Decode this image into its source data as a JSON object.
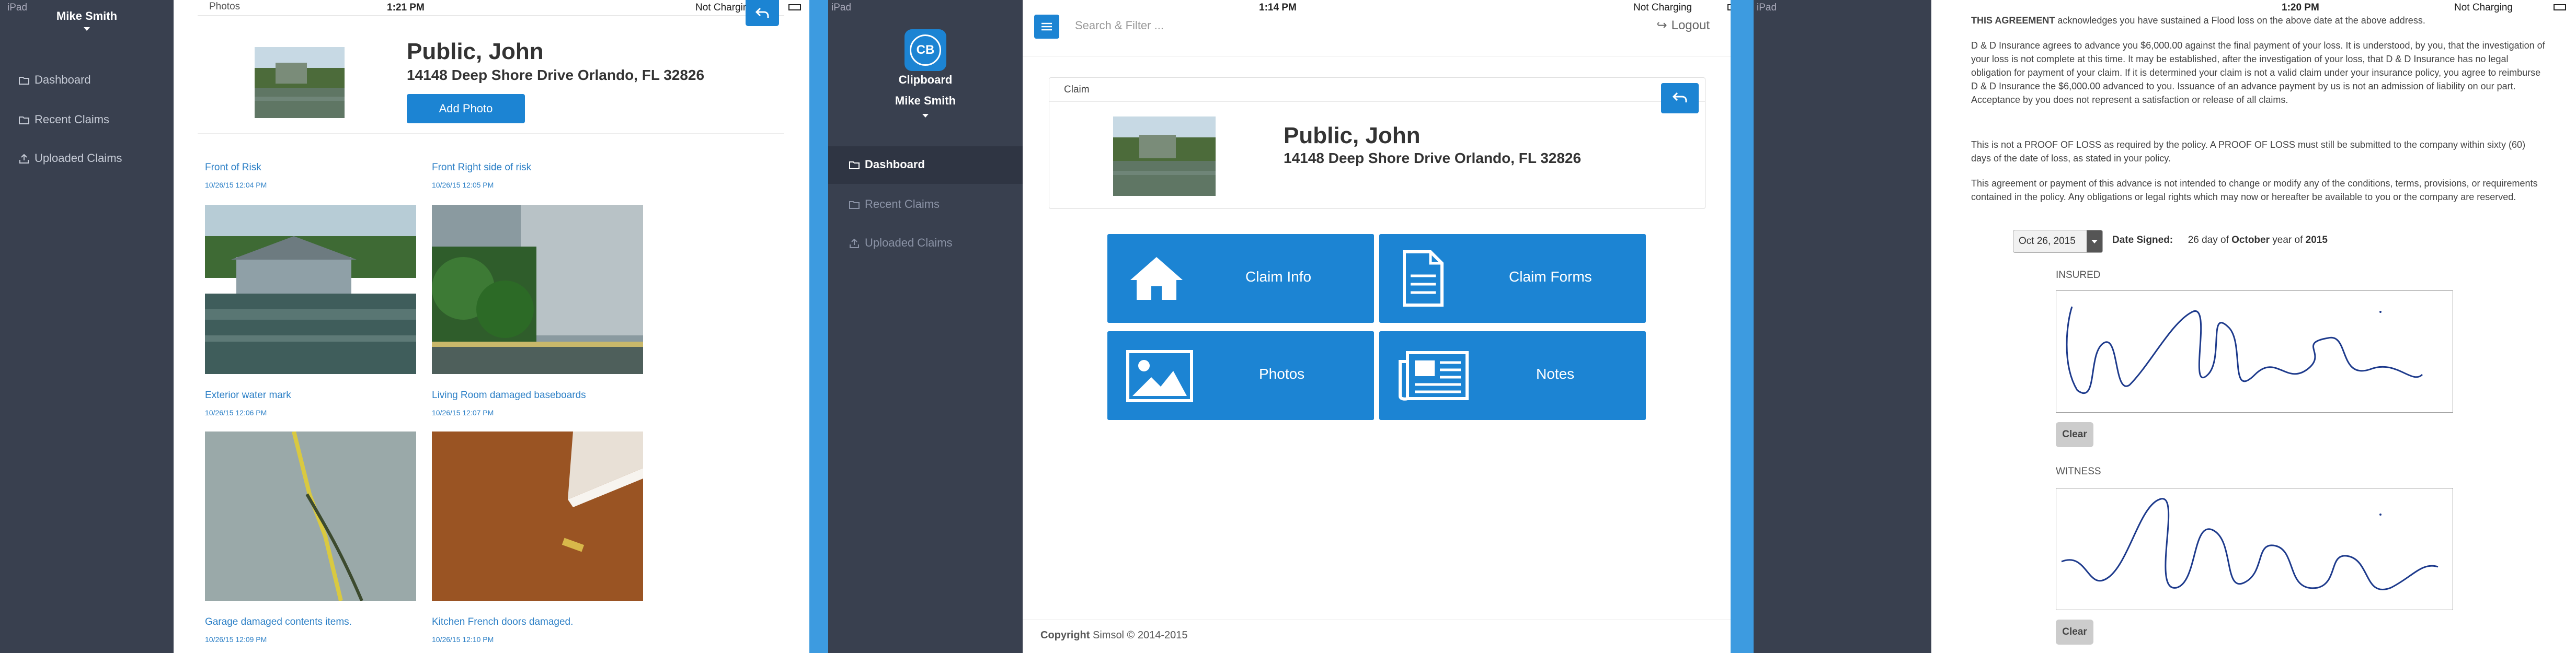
{
  "panel1": {
    "status": {
      "device": "iPad",
      "time": "1:21 PM",
      "battery": "Not Charging"
    },
    "user": "Mike Smith",
    "nav": [
      "Dashboard",
      "Recent Claims",
      "Uploaded Claims"
    ],
    "section_title": "Photos",
    "claimant": {
      "name": "Public, John",
      "address": "14148 Deep Shore Drive Orlando, FL 32826"
    },
    "add_photo": "Add Photo",
    "photos": [
      {
        "caption": "Front of Risk",
        "time": "10/26/15 12:04 PM"
      },
      {
        "caption": "Front Right side of risk",
        "time": "10/26/15 12:05 PM"
      },
      {
        "caption": "Exterior water mark",
        "time": "10/26/15 12:06 PM"
      },
      {
        "caption": "Living Room damaged baseboards",
        "time": "10/26/15 12:07 PM"
      },
      {
        "caption": "Garage damaged contents items.",
        "time": "10/26/15 12:09 PM"
      },
      {
        "caption": "Kitchen French doors damaged.",
        "time": "10/26/15 12:10 PM"
      }
    ]
  },
  "panel2": {
    "status": {
      "device": "iPad",
      "time": "1:14 PM",
      "battery": "Not Charging"
    },
    "app_name": "Clipboard",
    "logo_text": "CB",
    "user": "Mike Smith",
    "nav": [
      "Dashboard",
      "Recent Claims",
      "Uploaded Claims"
    ],
    "search_placeholder": "Search & Filter ...",
    "logout": "Logout",
    "claim_label": "Claim",
    "claimant": {
      "name": "Public, John",
      "address": "14148 Deep Shore Drive Orlando, FL 32826"
    },
    "tiles": [
      "Claim Info",
      "Claim Forms",
      "Photos",
      "Notes"
    ],
    "footer_bold": "Copyright",
    "footer_rest": " Simsol © 2014-2015"
  },
  "panel3": {
    "status": {
      "device": "iPad",
      "time": "1:20 PM",
      "battery": "Not Charging"
    },
    "top_line_bold": "THIS AGREEMENT",
    "top_line_rest": " acknowledges you have sustained a Flood loss on the above date at the above address.",
    "para1": "D & D Insurance agrees to advance you $6,000.00 against the final payment of your loss. It is understood, by you, that the investigation of your loss is not complete at this time. It may be established, after the investigation of your loss, that D & D Insurance has no legal obligation for payment of your claim. If it is determined your claim is not a valid claim under your insurance policy, you agree to reimburse D & D Insurance the $6,000.00 advanced to you. Issuance of an advance payment by us is not an admission of liability on our part. Acceptance by you does not represent a satisfaction or release of all claims.",
    "para2": "This is not a PROOF OF LOSS as required by the policy. A PROOF OF LOSS must still be submitted to the company within sixty (60) days of the date of loss, as stated in your policy.",
    "para3": "This agreement or payment of this advance is not intended to change or modify any of the conditions, terms, provisions, or requirements contained in the policy. Any obligations or legal rights which may now or hereafter be available to you or the company are reserved.",
    "date_select": "Oct 26, 2015",
    "date_signed_label": "Date Signed:",
    "day": "26",
    "day_of": "day of",
    "month": "October",
    "year_of": "year of",
    "year": "2015",
    "insured_label": "INSURED",
    "witness_label": "WITNESS",
    "clear": "Clear"
  },
  "colors": {
    "sidebar": "#39404f",
    "accent": "#1c84d3",
    "frame_blue": "#3d9be0"
  }
}
